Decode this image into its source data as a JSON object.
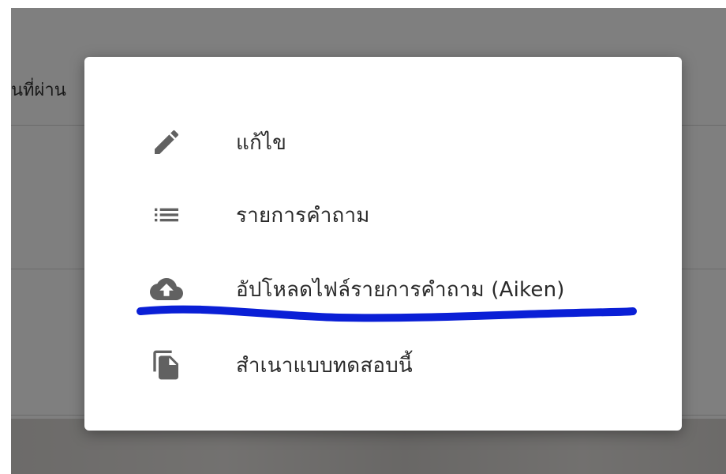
{
  "background": {
    "header_text": "นที่ผ่าน"
  },
  "menu": {
    "items": [
      {
        "label": "แก้ไข",
        "icon": "pencil-icon"
      },
      {
        "label": "รายการคำถาม",
        "icon": "list-icon"
      },
      {
        "label": "อัปโหลดไฟล์รายการคำถาม (Aiken)",
        "icon": "cloud-upload-icon"
      },
      {
        "label": "สำเนาแบบทดสอบนี้",
        "icon": "copy-icon"
      }
    ]
  },
  "annotation": {
    "underline_color": "#0a1fd6"
  },
  "colors": {
    "icon": "#616161",
    "text": "#2a2a2a",
    "scrim": "rgba(0,0,0,0.5)"
  }
}
